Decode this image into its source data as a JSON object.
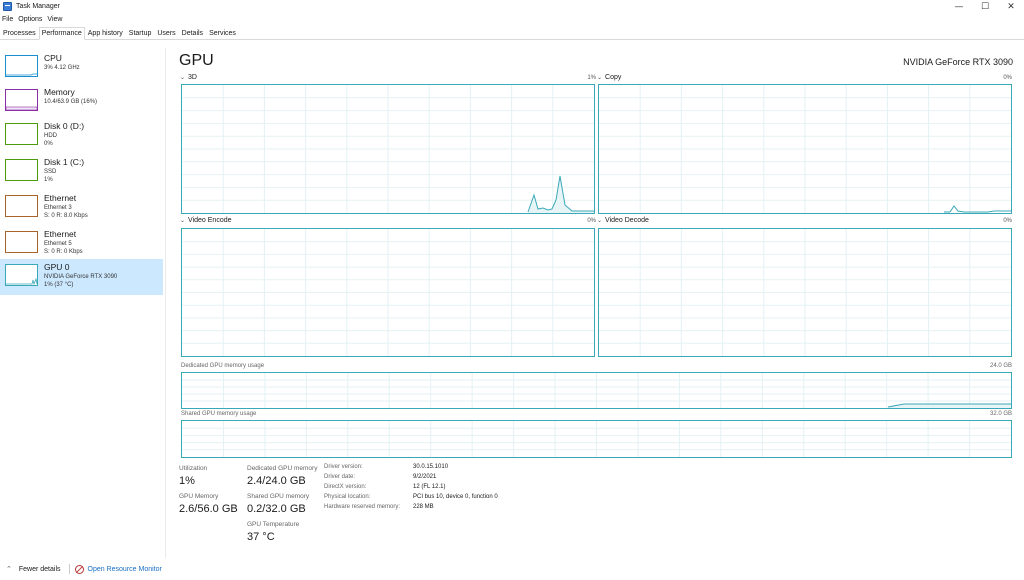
{
  "window": {
    "title": "Task Manager",
    "minimize_glyph": "—",
    "maximize_glyph": "☐",
    "close_glyph": "✕"
  },
  "menu": [
    "File",
    "Options",
    "View"
  ],
  "tabs": [
    "Processes",
    "Performance",
    "App history",
    "Startup",
    "Users",
    "Details",
    "Services"
  ],
  "active_tab": "Performance",
  "sidebar": {
    "items": [
      {
        "title": "CPU",
        "sub1": "3% 4.12 GHz",
        "sub2": "",
        "color": "#1a8fd0"
      },
      {
        "title": "Memory",
        "sub1": "10.4/63.9 GB (16%)",
        "sub2": "",
        "color": "#8b2ea6"
      },
      {
        "title": "Disk 0 (D:)",
        "sub1": "HDD",
        "sub2": "0%",
        "color": "#4d9a0f"
      },
      {
        "title": "Disk 1 (C:)",
        "sub1": "SSD",
        "sub2": "1%",
        "color": "#4d9a0f"
      },
      {
        "title": "Ethernet",
        "sub1": "Ethernet 3",
        "sub2": "S: 0  R: 8.0 Kbps",
        "color": "#a7652a"
      },
      {
        "title": "Ethernet",
        "sub1": "Ethernet 5",
        "sub2": "S: 0  R: 0 Kbps",
        "color": "#a7652a"
      },
      {
        "title": "GPU 0",
        "sub1": "NVIDIA GeForce RTX 3090",
        "sub2": "1% (37 °C)",
        "color": "#3ba8b8"
      }
    ]
  },
  "main": {
    "heading": "GPU",
    "model": "NVIDIA GeForce RTX 3090",
    "graphs": [
      {
        "label": "3D",
        "pct": "1%"
      },
      {
        "label": "Copy",
        "pct": "0%"
      },
      {
        "label": "Video Encode",
        "pct": "0%"
      },
      {
        "label": "Video Decode",
        "pct": "0%"
      }
    ],
    "dedicated": {
      "label": "Dedicated GPU memory usage",
      "max": "24.0 GB"
    },
    "shared": {
      "label": "Shared GPU memory usage",
      "max": "32.0 GB"
    }
  },
  "stats": {
    "utilization_label": "Utilization",
    "utilization_value": "1%",
    "gpu_memory_label": "GPU Memory",
    "gpu_memory_value": "2.6/56.0 GB",
    "dedicated_label": "Dedicated GPU memory",
    "dedicated_value": "2.4/24.0 GB",
    "shared_label": "Shared GPU memory",
    "shared_value": "0.2/32.0 GB",
    "temp_label": "GPU Temperature",
    "temp_value": "37 °C"
  },
  "info": [
    {
      "key": "Driver version:",
      "value": "30.0.15.1010"
    },
    {
      "key": "Driver date:",
      "value": "9/2/2021"
    },
    {
      "key": "DirectX version:",
      "value": "12 (FL 12.1)"
    },
    {
      "key": "Physical location:",
      "value": "PCI bus 10, device 0, function 0"
    },
    {
      "key": "Hardware reserved memory:",
      "value": "228 MB"
    }
  ],
  "footer": {
    "fewer_details": "Fewer details",
    "resource_monitor": "Open Resource Monitor"
  },
  "colors": {
    "gpu_accent": "#3ba8b8",
    "selected_bg": "#cce8ff",
    "link": "#1a6fc4"
  }
}
